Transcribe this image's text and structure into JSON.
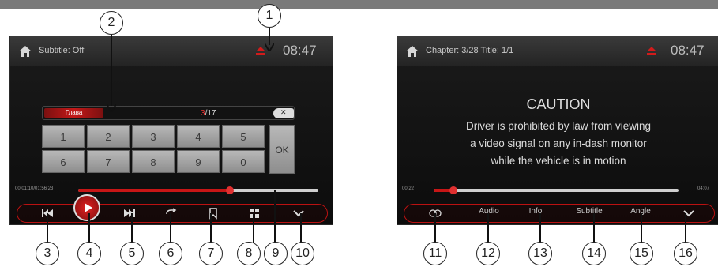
{
  "left_screen": {
    "status": {
      "subtitle_text": "Subtitle: Off",
      "clock": "08:47"
    },
    "chapter_entry": {
      "label": "Глава",
      "current": "3",
      "total": "/17"
    },
    "keypad": {
      "keys": [
        "1",
        "2",
        "3",
        "4",
        "5",
        "6",
        "7",
        "8",
        "9",
        "0"
      ],
      "ok": "OK"
    },
    "time": {
      "elapsed_total": "00:01:10/01:56:23"
    },
    "progress": 0.63,
    "controls": [
      "prev-icon",
      "play-icon",
      "next-icon",
      "repeat-icon",
      "bookmark-icon",
      "grid-icon",
      "chevron-down-icon"
    ]
  },
  "right_screen": {
    "status": {
      "chapter_text": "Chapter: 3/28 Title: 1/1",
      "clock": "08:47"
    },
    "caution": {
      "title": "CAUTION",
      "lines": [
        "Driver is prohibited by law from viewing",
        "a video signal on any in-dash monitor",
        "while the vehicle is in motion"
      ]
    },
    "time": {
      "elapsed": "00:22",
      "total": "04:07"
    },
    "progress": 0.08,
    "controls": {
      "audio": "Audio",
      "info": "Info",
      "subtitle": "Subtitle",
      "angle": "Angle"
    }
  },
  "callouts": [
    "1",
    "2",
    "3",
    "4",
    "5",
    "6",
    "7",
    "8",
    "9",
    "10",
    "11",
    "12",
    "13",
    "14",
    "15",
    "16"
  ],
  "colors": {
    "accent": "#c71616",
    "frame": "#7a7a7a"
  }
}
